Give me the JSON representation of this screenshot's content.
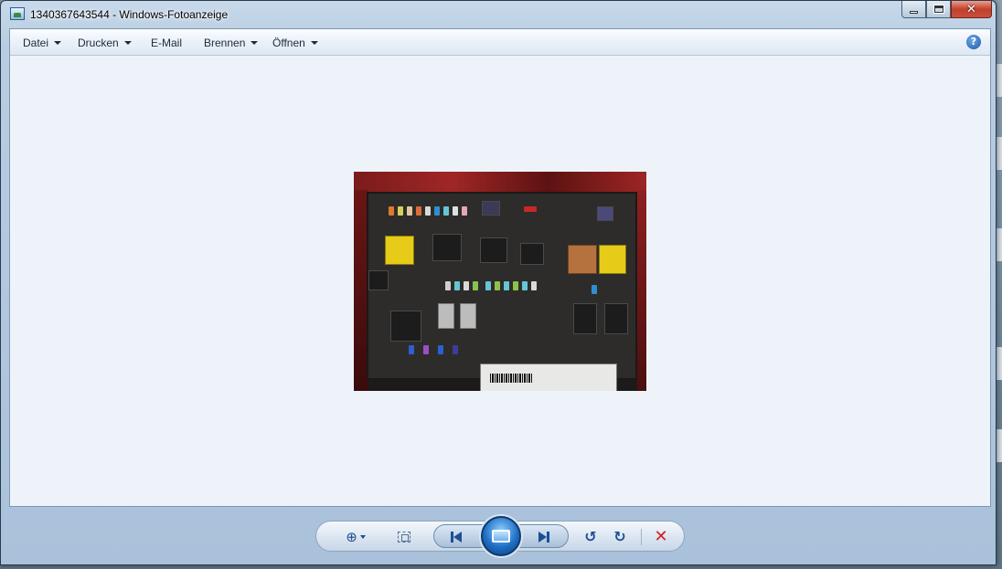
{
  "window": {
    "title": "1340367643544 - Windows-Fotoanzeige",
    "buttons": {
      "minimize": "minimize-icon",
      "maximize": "maximize-icon",
      "close": "close-icon"
    }
  },
  "menubar": {
    "items": [
      {
        "label": "Datei",
        "has_dropdown": true
      },
      {
        "label": "Drucken",
        "has_dropdown": true
      },
      {
        "label": "E-Mail",
        "has_dropdown": false
      },
      {
        "label": "Brennen",
        "has_dropdown": true
      },
      {
        "label": "Öffnen",
        "has_dropdown": true
      }
    ],
    "help_icon": "help-icon"
  },
  "viewer": {
    "image_description_icon": "photo-fuse-box"
  },
  "controls": {
    "zoom": "zoom-icon",
    "actual_size": "fit-window-icon",
    "previous": "previous-icon",
    "slideshow": "slideshow-icon",
    "next": "next-icon",
    "rotate_left": "rotate-ccw-icon",
    "rotate_right": "rotate-cw-icon",
    "delete": "delete-icon"
  },
  "colors": {
    "client_bg": "#eef3fa",
    "frame": "#b8cde2",
    "close_button": "#c4402c",
    "slideshow_button": "#1f6fc5"
  }
}
